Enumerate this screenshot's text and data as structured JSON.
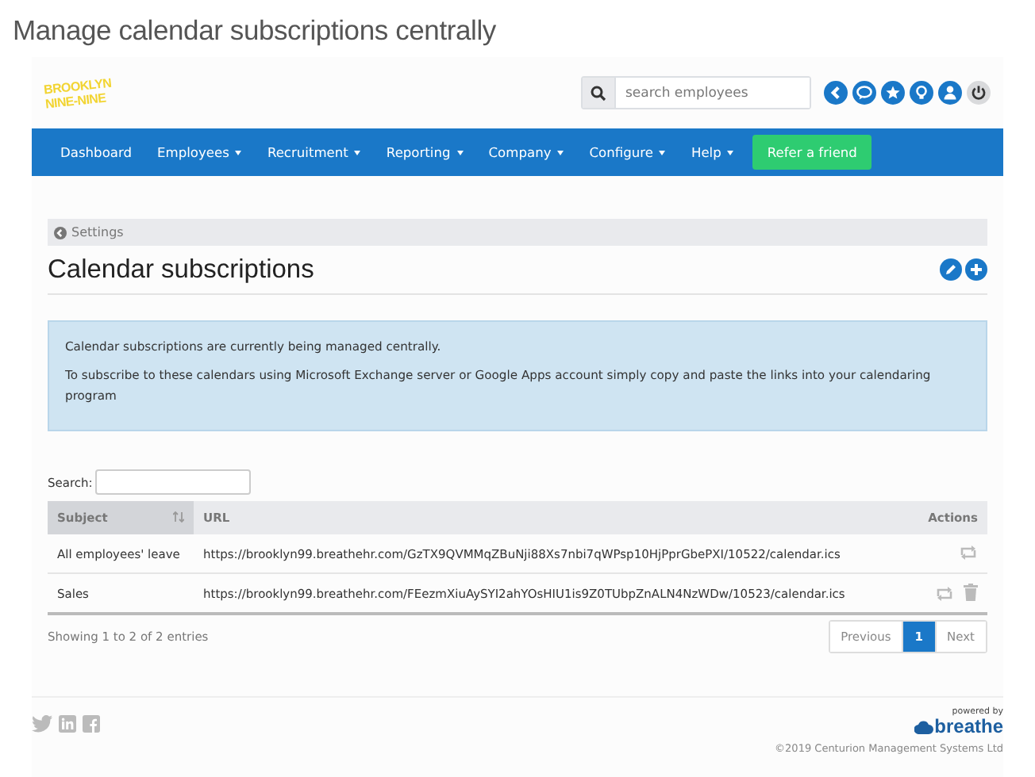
{
  "headline": "Manage calendar subscriptions centrally",
  "header": {
    "logo": [
      "BROOKLYN",
      "NINE-NINE"
    ],
    "search": {
      "placeholder": "search employees"
    }
  },
  "nav": [
    {
      "label": "Dashboard",
      "kind": "link",
      "dropdown": false
    },
    {
      "label": "Employees",
      "kind": "link",
      "dropdown": true
    },
    {
      "label": "Recruitment",
      "kind": "link",
      "dropdown": true
    },
    {
      "label": "Reporting",
      "kind": "link",
      "dropdown": true
    },
    {
      "label": "Company",
      "kind": "link",
      "dropdown": true
    },
    {
      "label": "Configure",
      "kind": "link",
      "dropdown": true
    },
    {
      "label": "Help",
      "kind": "link",
      "dropdown": true
    },
    {
      "label": "Refer a friend",
      "kind": "button",
      "dropdown": false
    }
  ],
  "breadcrumb": "Settings",
  "title": "Calendar subscriptions",
  "info": [
    "Calendar subscriptions are currently being managed centrally.",
    "To subscribe to these calendars using Microsoft Exchange server or Google Apps account simply copy and paste the links into your calendaring program"
  ],
  "table": {
    "search_label": "Search:",
    "columns": [
      {
        "label": "Subject",
        "sorted": true
      },
      {
        "label": "URL",
        "sorted": false
      },
      {
        "label": "Actions",
        "sorted": false
      }
    ],
    "rows": [
      {
        "subject": "All employees' leave",
        "url": "https://brooklyn99.breathehr.com/GzTX9QVMMqZBuNji88Xs7nbi7qWPsp10HjPprGbePXI/10522/calendar.ics",
        "deletable": false
      },
      {
        "subject": "Sales",
        "url": "https://brooklyn99.breathehr.com/FEezmXiuAySYI2ahYOsHIU1is9Z0TUbpZnALN4NzWDw/10523/calendar.ics",
        "deletable": true
      }
    ],
    "info": "Showing 1 to 2 of 2 entries",
    "pagination": [
      {
        "label": "Previous",
        "selected": false
      },
      {
        "label": "1",
        "selected": true
      },
      {
        "label": "Next",
        "selected": false
      }
    ]
  },
  "footer": {
    "powered_by": "powered by",
    "brand": "breathe",
    "copyright": "©2019 Centurion Management Systems Ltd"
  }
}
